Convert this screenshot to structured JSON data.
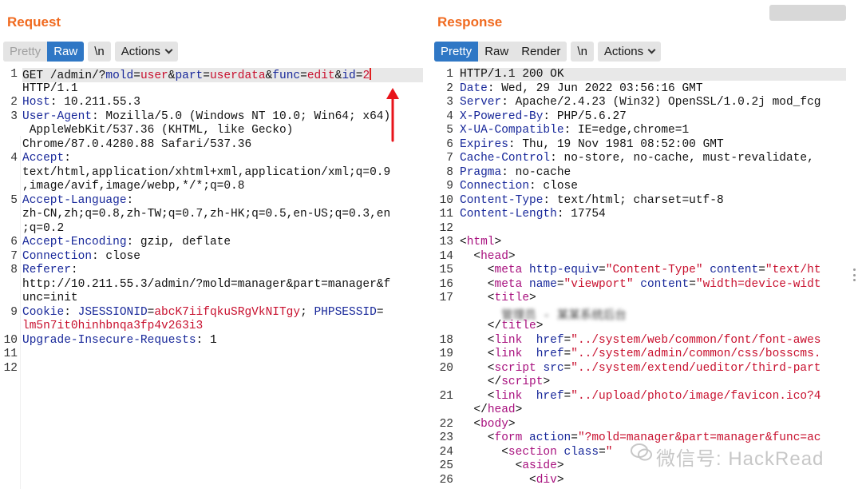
{
  "request": {
    "title": "Request",
    "toolbar": {
      "pretty": "Pretty",
      "raw": "Raw",
      "newline": "\\n",
      "actions": "Actions"
    },
    "line_numbers": [
      "1",
      "2",
      "3",
      "4",
      "5",
      "6",
      "7",
      "8",
      "9",
      "10",
      "11",
      "12"
    ],
    "lines": {
      "l1a": "GET /admin/?",
      "l1_k1": "mold",
      "l1_v1": "user",
      "l1_k2": "part",
      "l1_v2": "userdata",
      "l1_k3": "func",
      "l1_v3": "edit",
      "l1_k4": "id",
      "l1_v4": "2",
      "l1b": "HTTP/1.1",
      "l2k": "Host",
      "l2v": " 10.211.55.3",
      "l3k": "User-Agent",
      "l3v1": " Mozilla/5.0 (Windows NT 10.0; Win64; x64)",
      "l3v2": " AppleWebKit/537.36 (KHTML, like Gecko)",
      "l3v3": "Chrome/87.0.4280.88 Safari/537.36",
      "l4k": "Accept",
      "l4v1": "text/html,application/xhtml+xml,application/xml;q=0.9",
      "l4v2": ",image/avif,image/webp,*/*;q=0.8",
      "l5k": "Accept-Language",
      "l5v1": "zh-CN,zh;q=0.8,zh-TW;q=0.7,zh-HK;q=0.5,en-US;q=0.3,en",
      "l5v2": ";q=0.2",
      "l6k": "Accept-Encoding",
      "l6v": " gzip, deflate",
      "l7k": "Connection",
      "l7v": " close",
      "l8k": "Referer",
      "l8v1": "http://10.211.55.3/admin/?mold=manager&part=manager&f",
      "l8v2": "unc=init",
      "l9k": "Cookie",
      "l9k1": "JSESSIONID",
      "l9v1": "abcK7iifqkuSRgVkNITgy",
      "l9k2": "PHPSESSID",
      "l9v2": "lm5n7it0hinhbnqa3fp4v263i3",
      "l10k": "Upgrade-Insecure-Requests",
      "l10v": " 1"
    }
  },
  "response": {
    "title": "Response",
    "toolbar": {
      "pretty": "Pretty",
      "raw": "Raw",
      "render": "Render",
      "newline": "\\n",
      "actions": "Actions"
    },
    "line_numbers": [
      "1",
      "2",
      "3",
      "4",
      "5",
      "6",
      "7",
      "8",
      "9",
      "10",
      "11",
      "12",
      "13",
      "14",
      "15",
      "16",
      "17",
      "18",
      "19",
      "20",
      "21",
      "22",
      "23",
      "24",
      "25",
      "26"
    ],
    "lines": {
      "r1": "HTTP/1.1 200 OK",
      "r2k": "Date",
      "r2v": " Wed, 29 Jun 2022 03:56:16 GMT",
      "r3k": "Server",
      "r3v": " Apache/2.4.23 (Win32) OpenSSL/1.0.2j mod_fcg",
      "r4k": "X-Powered-By",
      "r4v": " PHP/5.6.27",
      "r5k": "X-UA-Compatible",
      "r5v": " IE=edge,chrome=1",
      "r6k": "Expires",
      "r6v": " Thu, 19 Nov 1981 08:52:00 GMT",
      "r7k": "Cache-Control",
      "r7v": " no-store, no-cache, must-revalidate,",
      "r8k": "Pragma",
      "r8v": " no-cache",
      "r9k": "Connection",
      "r9v": " close",
      "r10k": "Content-Type",
      "r10v": " text/html; charset=utf-8",
      "r11k": "Content-Length",
      "r11v": " 17754",
      "html": "html",
      "head": "head",
      "meta": "meta",
      "title": "title",
      "link": "link",
      "script": "script",
      "body": "body",
      "form": "form",
      "section": "section",
      "aside": "aside",
      "div": "div",
      "a_http_equiv": "http-equiv",
      "s_content_type": "\"Content-Type\"",
      "a_content": "content",
      "s_text_ht": "\"text/ht",
      "a_name": "name",
      "s_viewport": "\"viewport\"",
      "s_width": "\"width=device-widt",
      "a_href": "href",
      "s_font": "\"../system/web/common/font/font-awes",
      "s_css": "\"../system/admin/common/css/bosscms.",
      "a_src": "src",
      "s_ueditor": "\"../system/extend/ueditor/third-part",
      "s_favicon": "\"../upload/photo/image/favicon.ico?4",
      "a_action": "action",
      "s_action": "\"?mold=manager&part=manager&func=ac",
      "a_class": "class",
      "s_class": "\"",
      "title_text": "管理员 - 某某系统后台"
    }
  },
  "watermark": {
    "text": "微信号: HackRead"
  },
  "colors": {
    "accent": "#f06a1f",
    "active": "#2f77c5",
    "key": "#18289a",
    "value": "#c8102e",
    "tag": "#a8107e"
  }
}
